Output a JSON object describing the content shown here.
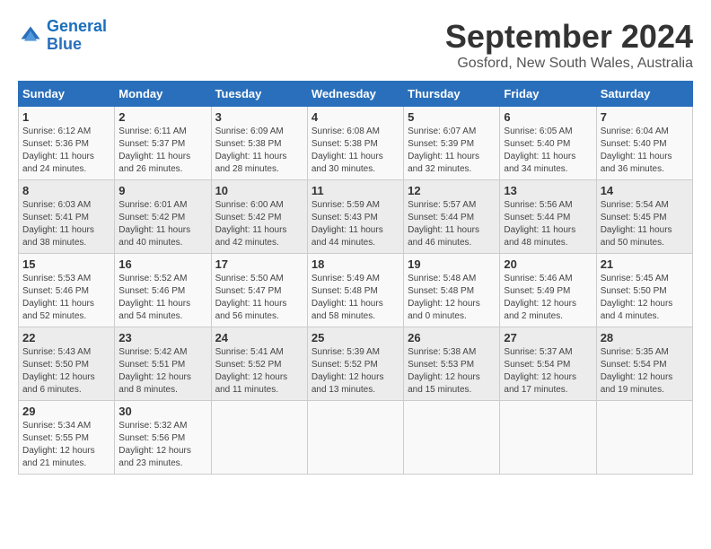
{
  "logo": {
    "line1": "General",
    "line2": "Blue"
  },
  "title": "September 2024",
  "subtitle": "Gosford, New South Wales, Australia",
  "days_of_week": [
    "Sunday",
    "Monday",
    "Tuesday",
    "Wednesday",
    "Thursday",
    "Friday",
    "Saturday"
  ],
  "weeks": [
    [
      {
        "day": 1,
        "info": "Sunrise: 6:12 AM\nSunset: 5:36 PM\nDaylight: 11 hours\nand 24 minutes."
      },
      {
        "day": 2,
        "info": "Sunrise: 6:11 AM\nSunset: 5:37 PM\nDaylight: 11 hours\nand 26 minutes."
      },
      {
        "day": 3,
        "info": "Sunrise: 6:09 AM\nSunset: 5:38 PM\nDaylight: 11 hours\nand 28 minutes."
      },
      {
        "day": 4,
        "info": "Sunrise: 6:08 AM\nSunset: 5:38 PM\nDaylight: 11 hours\nand 30 minutes."
      },
      {
        "day": 5,
        "info": "Sunrise: 6:07 AM\nSunset: 5:39 PM\nDaylight: 11 hours\nand 32 minutes."
      },
      {
        "day": 6,
        "info": "Sunrise: 6:05 AM\nSunset: 5:40 PM\nDaylight: 11 hours\nand 34 minutes."
      },
      {
        "day": 7,
        "info": "Sunrise: 6:04 AM\nSunset: 5:40 PM\nDaylight: 11 hours\nand 36 minutes."
      }
    ],
    [
      {
        "day": 8,
        "info": "Sunrise: 6:03 AM\nSunset: 5:41 PM\nDaylight: 11 hours\nand 38 minutes."
      },
      {
        "day": 9,
        "info": "Sunrise: 6:01 AM\nSunset: 5:42 PM\nDaylight: 11 hours\nand 40 minutes."
      },
      {
        "day": 10,
        "info": "Sunrise: 6:00 AM\nSunset: 5:42 PM\nDaylight: 11 hours\nand 42 minutes."
      },
      {
        "day": 11,
        "info": "Sunrise: 5:59 AM\nSunset: 5:43 PM\nDaylight: 11 hours\nand 44 minutes."
      },
      {
        "day": 12,
        "info": "Sunrise: 5:57 AM\nSunset: 5:44 PM\nDaylight: 11 hours\nand 46 minutes."
      },
      {
        "day": 13,
        "info": "Sunrise: 5:56 AM\nSunset: 5:44 PM\nDaylight: 11 hours\nand 48 minutes."
      },
      {
        "day": 14,
        "info": "Sunrise: 5:54 AM\nSunset: 5:45 PM\nDaylight: 11 hours\nand 50 minutes."
      }
    ],
    [
      {
        "day": 15,
        "info": "Sunrise: 5:53 AM\nSunset: 5:46 PM\nDaylight: 11 hours\nand 52 minutes."
      },
      {
        "day": 16,
        "info": "Sunrise: 5:52 AM\nSunset: 5:46 PM\nDaylight: 11 hours\nand 54 minutes."
      },
      {
        "day": 17,
        "info": "Sunrise: 5:50 AM\nSunset: 5:47 PM\nDaylight: 11 hours\nand 56 minutes."
      },
      {
        "day": 18,
        "info": "Sunrise: 5:49 AM\nSunset: 5:48 PM\nDaylight: 11 hours\nand 58 minutes."
      },
      {
        "day": 19,
        "info": "Sunrise: 5:48 AM\nSunset: 5:48 PM\nDaylight: 12 hours\nand 0 minutes."
      },
      {
        "day": 20,
        "info": "Sunrise: 5:46 AM\nSunset: 5:49 PM\nDaylight: 12 hours\nand 2 minutes."
      },
      {
        "day": 21,
        "info": "Sunrise: 5:45 AM\nSunset: 5:50 PM\nDaylight: 12 hours\nand 4 minutes."
      }
    ],
    [
      {
        "day": 22,
        "info": "Sunrise: 5:43 AM\nSunset: 5:50 PM\nDaylight: 12 hours\nand 6 minutes."
      },
      {
        "day": 23,
        "info": "Sunrise: 5:42 AM\nSunset: 5:51 PM\nDaylight: 12 hours\nand 8 minutes."
      },
      {
        "day": 24,
        "info": "Sunrise: 5:41 AM\nSunset: 5:52 PM\nDaylight: 12 hours\nand 11 minutes."
      },
      {
        "day": 25,
        "info": "Sunrise: 5:39 AM\nSunset: 5:52 PM\nDaylight: 12 hours\nand 13 minutes."
      },
      {
        "day": 26,
        "info": "Sunrise: 5:38 AM\nSunset: 5:53 PM\nDaylight: 12 hours\nand 15 minutes."
      },
      {
        "day": 27,
        "info": "Sunrise: 5:37 AM\nSunset: 5:54 PM\nDaylight: 12 hours\nand 17 minutes."
      },
      {
        "day": 28,
        "info": "Sunrise: 5:35 AM\nSunset: 5:54 PM\nDaylight: 12 hours\nand 19 minutes."
      }
    ],
    [
      {
        "day": 29,
        "info": "Sunrise: 5:34 AM\nSunset: 5:55 PM\nDaylight: 12 hours\nand 21 minutes."
      },
      {
        "day": 30,
        "info": "Sunrise: 5:32 AM\nSunset: 5:56 PM\nDaylight: 12 hours\nand 23 minutes."
      },
      null,
      null,
      null,
      null,
      null
    ]
  ]
}
